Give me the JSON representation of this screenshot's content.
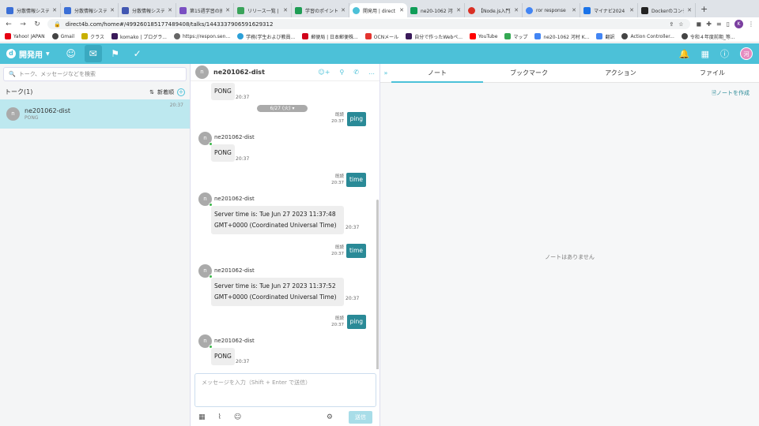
{
  "browser": {
    "tabs": [
      {
        "title": "分散情報システム",
        "color": "#3b6fd6"
      },
      {
        "title": "分散情報システム",
        "color": "#3b6fd6"
      },
      {
        "title": "分散情報システム",
        "color": "#4257b2"
      },
      {
        "title": "第15週学習の振り",
        "color": "#7a4fc2"
      },
      {
        "title": "リリース一覧 | T",
        "color": "#3aa35a"
      },
      {
        "title": "学習のポイント",
        "color": "#1f9d55"
      },
      {
        "title": "開発用 | direct",
        "color": "#4cc1d8",
        "active": true
      },
      {
        "title": "ne20-1062 河村",
        "color": "#0f9d58"
      },
      {
        "title": "【Node.js入門】",
        "color": "#d93025"
      },
      {
        "title": "ror response",
        "color": "#4285f4"
      },
      {
        "title": "マイナビ2024",
        "color": "#1a73e8"
      },
      {
        "title": "Dockerのコンテ",
        "color": "#222222"
      }
    ],
    "url": "direct4b.com/home#/499260185177489408/talks/1443337906591629312",
    "bookmarks": [
      "Yahoo! JAPAN",
      "Gmail",
      "クラス",
      "komako | プログラ...",
      "https://respon.sen...",
      "学務(学生および教員...",
      "郵便局 | 日本郵便株...",
      "OCNメール",
      "自分で作ったWebペ...",
      "YouTube",
      "マップ",
      "ne20-1062 河村 K...",
      "翻訳",
      "Action Controller...",
      "令和４年度前期_等..."
    ]
  },
  "app": {
    "brand": "開発用",
    "user_initial": "河"
  },
  "left": {
    "search_placeholder": "トーク、メッセージなどを検索",
    "list_title": "トーク(1)",
    "sort_label": "新着順",
    "talks": [
      {
        "name": "ne201062-dist",
        "snippet": "PONG",
        "time": "20:37",
        "initial": "n"
      }
    ]
  },
  "middle": {
    "talk_name": "ne201062-dist",
    "talk_initial": "n",
    "date_pill": "6/27 (火)",
    "messages": [
      {
        "dir": "in",
        "text": "PONG",
        "time": "20:37"
      },
      {
        "dir": "out",
        "text": "ping",
        "read": "既読",
        "time": "20:37"
      },
      {
        "dir": "in",
        "sender": "ne201062-dist",
        "text": "PONG",
        "time": "20:37"
      },
      {
        "dir": "out",
        "text": "time",
        "read": "既読",
        "time": "20:37"
      },
      {
        "dir": "in",
        "sender": "ne201062-dist",
        "line1": "Server time is: Tue Jun 27 2023 11:37:48",
        "line2": "GMT+0000 (Coordinated Universal Time)",
        "time": "20:37"
      },
      {
        "dir": "out",
        "text": "time",
        "read": "既読",
        "time": "20:37"
      },
      {
        "dir": "in",
        "sender": "ne201062-dist",
        "line1": "Server time is: Tue Jun 27 2023 11:37:52",
        "line2": "GMT+0000 (Coordinated Universal Time)",
        "time": "20:37"
      },
      {
        "dir": "out",
        "text": "ping",
        "read": "既読",
        "time": "20:37"
      },
      {
        "dir": "in",
        "sender": "ne201062-dist",
        "text": "PONG",
        "time": "20:37"
      }
    ],
    "composer_placeholder": "メッセージを入力（Shift + Enter で送信）",
    "send_label": "送信"
  },
  "right": {
    "tabs": [
      "ノート",
      "ブックマーク",
      "アクション",
      "ファイル"
    ],
    "create_note": "ノートを作成",
    "empty_text": "ノートはありません"
  }
}
